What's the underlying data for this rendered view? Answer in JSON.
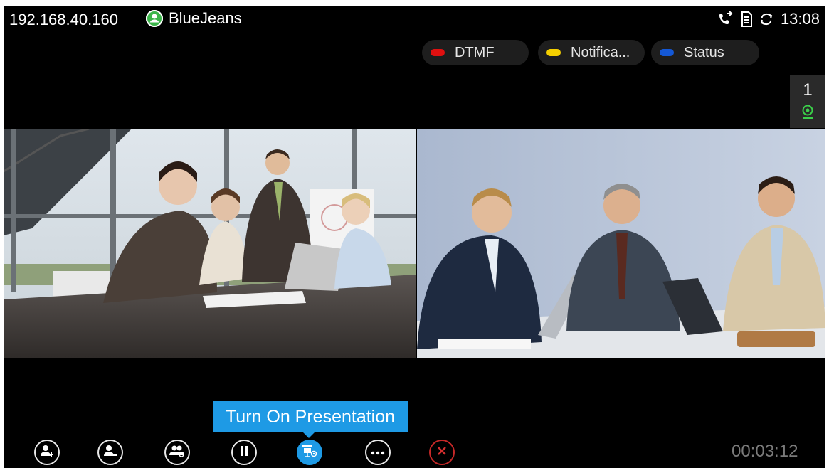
{
  "status_bar": {
    "ip_address": "192.168.40.160",
    "account_name": "BlueJeans",
    "time": "13:08",
    "icons": [
      "user-circle-icon",
      "call-forward-icon",
      "sd-card-icon",
      "sync-icon"
    ]
  },
  "softkeys": [
    {
      "label": "DTMF",
      "color": "#e01010"
    },
    {
      "label": "Notifica...",
      "color": "#f5d000"
    },
    {
      "label": "Status",
      "color": "#1458d6"
    }
  ],
  "layout_indicator": {
    "number": "1",
    "icon": "camera-icon"
  },
  "tooltip": {
    "text": "Turn On Presentation"
  },
  "toolbar": {
    "buttons": [
      {
        "name": "add-participant",
        "icon": "user-add-icon"
      },
      {
        "name": "remove-participant",
        "icon": "user-remove-icon"
      },
      {
        "name": "participants",
        "icon": "group-icon"
      },
      {
        "name": "hold",
        "icon": "pause-icon"
      },
      {
        "name": "presentation",
        "icon": "presentation-icon",
        "active": true
      },
      {
        "name": "more",
        "icon": "more-icon"
      },
      {
        "name": "hang-up",
        "icon": "close-icon"
      }
    ],
    "accent_color": "#1e9ae5",
    "hangup_color": "#c62828"
  },
  "call_timer": "00:03:12"
}
